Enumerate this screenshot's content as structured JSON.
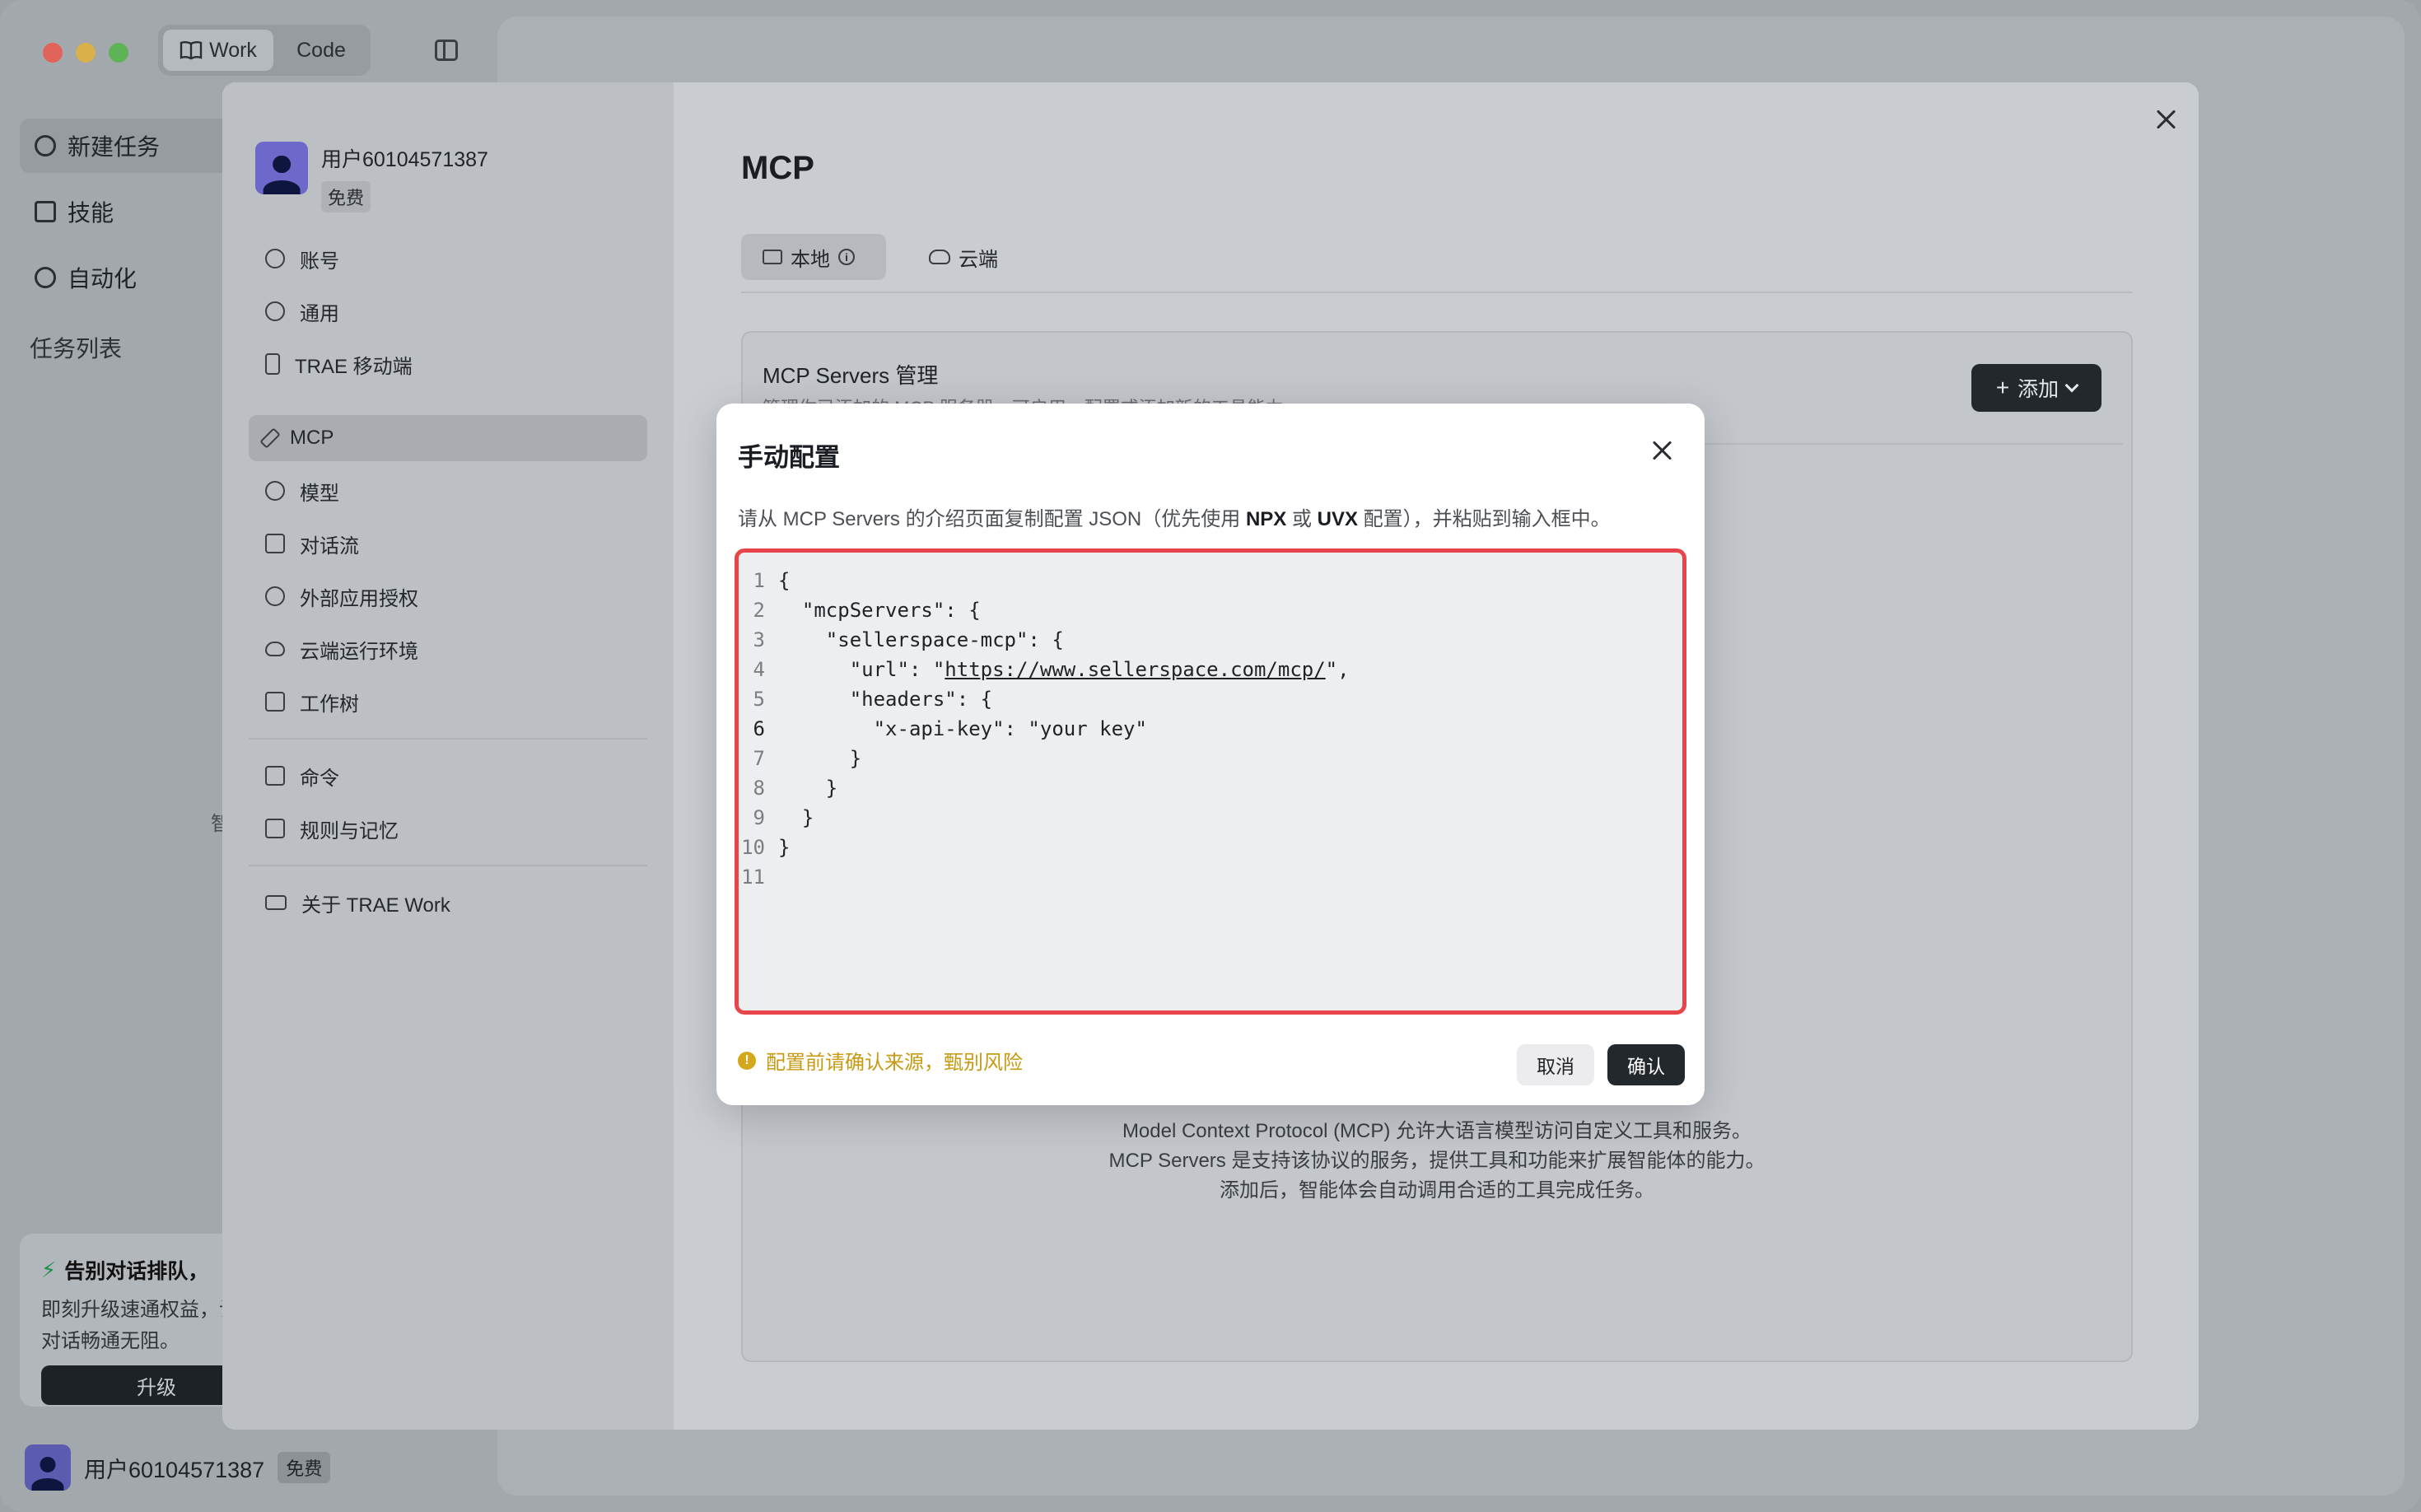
{
  "titlebar": {
    "modes": [
      {
        "label": "Work"
      },
      {
        "label": "Code"
      }
    ]
  },
  "left_nav": {
    "items": [
      {
        "label": "新建任务"
      },
      {
        "label": "技能"
      },
      {
        "label": "自动化"
      }
    ],
    "task_list_label": "任务列表",
    "stray_char": "智"
  },
  "promo": {
    "title": "告别对话排队，",
    "text": "即刻升级速通权益，让你的对话畅通无阻。",
    "button_label": "升级"
  },
  "bottom_user": {
    "name": "用户60104571387",
    "badge": "免费"
  },
  "settings": {
    "user": {
      "name": "用户60104571387",
      "badge": "免费"
    },
    "nav": [
      {
        "label": "账号"
      },
      {
        "label": "通用"
      },
      {
        "label": "TRAE 移动端"
      },
      {
        "label": "MCP"
      },
      {
        "label": "模型"
      },
      {
        "label": "对话流"
      },
      {
        "label": "外部应用授权"
      },
      {
        "label": "云端运行环境"
      },
      {
        "label": "工作树"
      },
      {
        "label": "命令"
      },
      {
        "label": "规则与记忆"
      },
      {
        "label": "关于 TRAE Work"
      }
    ],
    "active_item": "MCP",
    "page_title": "MCP",
    "tabs": [
      {
        "label": "本地"
      },
      {
        "label": "云端"
      }
    ],
    "card": {
      "title": "MCP Servers 管理",
      "subtitle": "管理你已添加的 MCP 服务器，可启用、配置或添加新的工具能力",
      "add_label": "添加"
    },
    "description": [
      "Model Context Protocol (MCP) 允许大语言模型访问自定义工具和服务。",
      "MCP Servers 是支持该协议的服务，提供工具和功能来扩展智能体的能力。",
      "添加后，智能体会自动调用合适的工具完成任务。"
    ]
  },
  "dialog": {
    "title": "手动配置",
    "hint_pre": "请从 MCP Servers 的介绍页面复制配置 JSON（优先使用 ",
    "hint_npx": "NPX",
    "hint_or": " 或 ",
    "hint_uvx": "UVX",
    "hint_post": " 配置），并粘贴到输入框中。",
    "code_lines": [
      {
        "n": "1",
        "text": "{"
      },
      {
        "n": "2",
        "text": "  \"mcpServers\": {"
      },
      {
        "n": "3",
        "text": "    \"sellerspace-mcp\": {"
      },
      {
        "n": "4",
        "pre": "      \"url\": \"",
        "url": "https://www.sellerspace.com/mcp/",
        "post": "\","
      },
      {
        "n": "5",
        "text": "      \"headers\": {"
      },
      {
        "n": "6",
        "text": "        \"x-api-key\": \"your key\""
      },
      {
        "n": "7",
        "text": "      }"
      },
      {
        "n": "8",
        "text": "    }"
      },
      {
        "n": "9",
        "text": "  }"
      },
      {
        "n": "10",
        "text": "}"
      },
      {
        "n": "11",
        "text": ""
      }
    ],
    "current_line": "6",
    "warning": "配置前请确认来源，甄别风险",
    "cancel_label": "取消",
    "confirm_label": "确认"
  },
  "colors": {
    "highlight_border": "#e8454a",
    "warning": "#c79a14",
    "primary_button": "#23282d"
  }
}
